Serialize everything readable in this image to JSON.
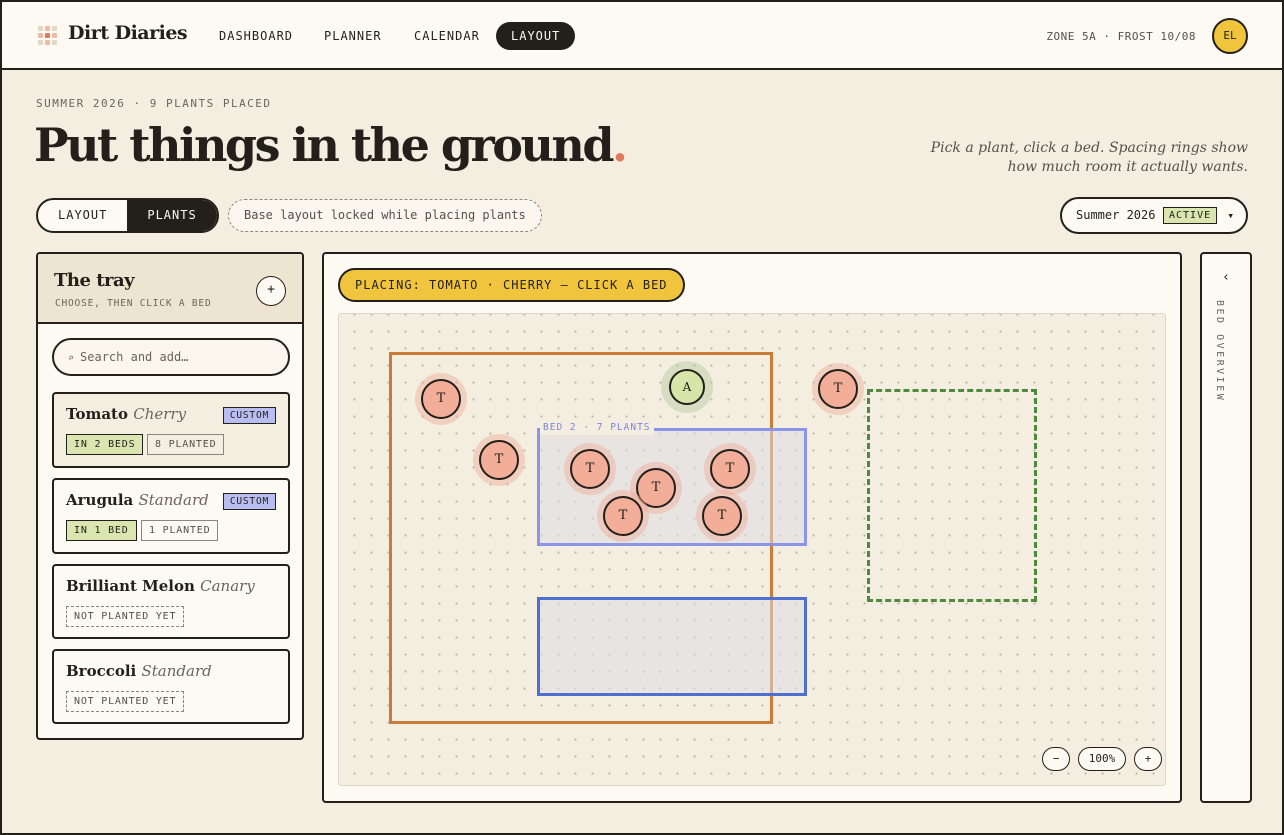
{
  "app": {
    "name": "Dirt Diaries"
  },
  "nav": {
    "items": [
      "DASHBOARD",
      "PLANNER",
      "CALENDAR",
      "LAYOUT"
    ],
    "active": "LAYOUT"
  },
  "header": {
    "zone_info": "ZONE 5A · FROST 10/08",
    "avatar_initials": "EL"
  },
  "hero": {
    "eyebrow": "SUMMER 2026 · 9 PLANTS PLACED",
    "title": "Put things in the ground",
    "title_dot": ".",
    "tagline_line1": "Pick a plant, click a bed. Spacing rings show",
    "tagline_line2": "how much room it actually wants."
  },
  "mode_toggle": {
    "layout": "LAYOUT",
    "plants": "PLANTS",
    "selected": "PLANTS"
  },
  "lock_notice": "Base layout locked while placing plants",
  "season": {
    "label": "Summer 2026",
    "badge": "ACTIVE",
    "caret": "▾"
  },
  "tray": {
    "title": "The tray",
    "subtitle": "CHOOSE, THEN CLICK A BED",
    "add_label": "+",
    "search_placeholder": "Search and add…",
    "search_icon": "search-icon",
    "items": [
      {
        "name": "Tomato",
        "variety": "Cherry",
        "badge": "CUSTOM",
        "chips": [
          "IN 2 BEDS",
          "8 PLANTED"
        ],
        "selected": true
      },
      {
        "name": "Arugula",
        "variety": "Standard",
        "badge": "CUSTOM",
        "chips": [
          "IN 1 BED",
          "1 PLANTED"
        ],
        "selected": false
      },
      {
        "name": "Brilliant Melon",
        "variety": "Canary",
        "badge": "",
        "chips": [
          "NOT PLANTED YET"
        ],
        "selected": false
      },
      {
        "name": "Broccoli",
        "variety": "Standard",
        "badge": "",
        "chips": [
          "NOT PLANTED YET"
        ],
        "selected": false
      }
    ]
  },
  "canvas": {
    "placing_banner": "PLACING: TOMATO · CHERRY — CLICK A BED",
    "bed2_label": "BED 2 · 7 PLANTS",
    "plant_tomato_letter": "T",
    "plant_arugula_letter": "A",
    "zoom": {
      "out": "−",
      "level": "100%",
      "in": "+"
    }
  },
  "overview": {
    "chevron": "‹",
    "label": "BED OVERVIEW"
  },
  "colors": {
    "background": "#f4eee0",
    "ink": "#231f1a",
    "accent_yellow": "#f0c53d",
    "tomato": "#f2ae98",
    "arugula": "#d8e5a8",
    "bed_orange": "#c97b3a",
    "bed_lavender": "#8a94e8",
    "bed_blue": "#4f6fcf",
    "bed_green": "#4f8a3c"
  }
}
